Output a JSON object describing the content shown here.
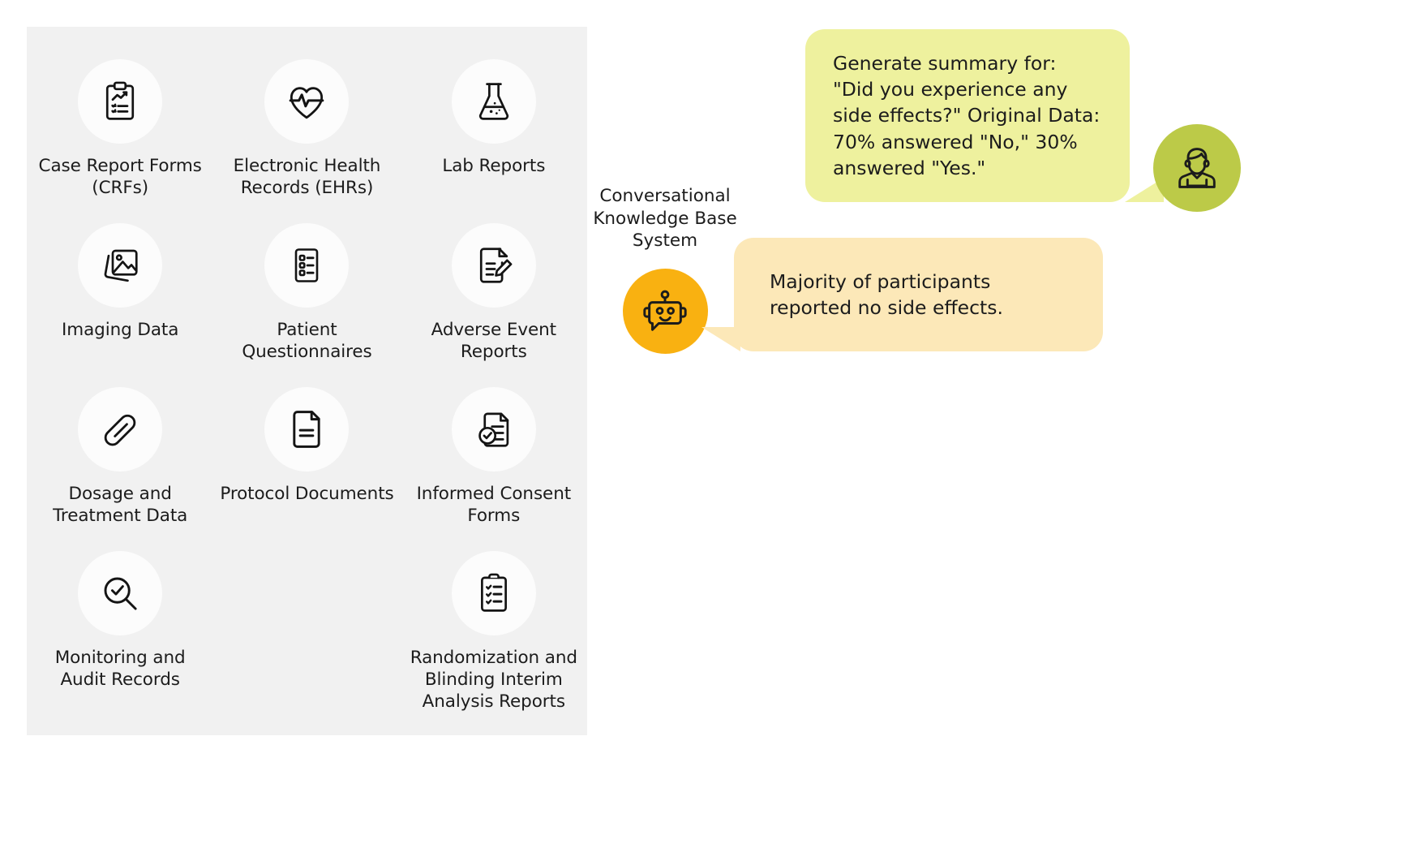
{
  "data_panel": {
    "name": "clinical-trial-data-sources",
    "background_color": "#f1f1f1",
    "items": [
      {
        "label": "Case Report Forms (CRFs)",
        "icon": "clipboard-chart-icon"
      },
      {
        "label": "Electronic Health Records (EHRs)",
        "icon": "heart-pulse-icon"
      },
      {
        "label": "Lab Reports",
        "icon": "flask-icon"
      },
      {
        "label": "Imaging Data",
        "icon": "photo-stack-icon"
      },
      {
        "label": "Patient Questionnaires",
        "icon": "checklist-form-icon"
      },
      {
        "label": "Adverse Event Reports",
        "icon": "document-pencil-icon"
      },
      {
        "label": "Dosage and Treatment Data",
        "icon": "pill-capsule-icon"
      },
      {
        "label": "Protocol Documents",
        "icon": "document-lines-icon"
      },
      {
        "label": "Informed Consent Forms",
        "icon": "document-check-icon"
      },
      {
        "label": "Monitoring and Audit Records",
        "icon": "magnifier-check-icon"
      },
      {
        "label": "",
        "icon": ""
      },
      {
        "label": "Randomization and Blinding Interim Analysis Reports",
        "icon": "clipboard-checklist-icon"
      }
    ]
  },
  "system_node": {
    "label": "Conversational Knowledge Base System",
    "icon": "robot-chat-icon",
    "circle_color": "#f9b111"
  },
  "conversation": {
    "user_message": {
      "text": "Generate summary for: \"Did you experience any side effects?\" Original Data: 70% answered \"No,\" 30% answered \"Yes.\"",
      "bubble_color": "#eef19e",
      "avatar_icon": "person-avatar-icon",
      "avatar_color": "#bcca48"
    },
    "system_message": {
      "text": "Majority of participants reported no side effects.",
      "bubble_color": "#fce8b8"
    }
  }
}
